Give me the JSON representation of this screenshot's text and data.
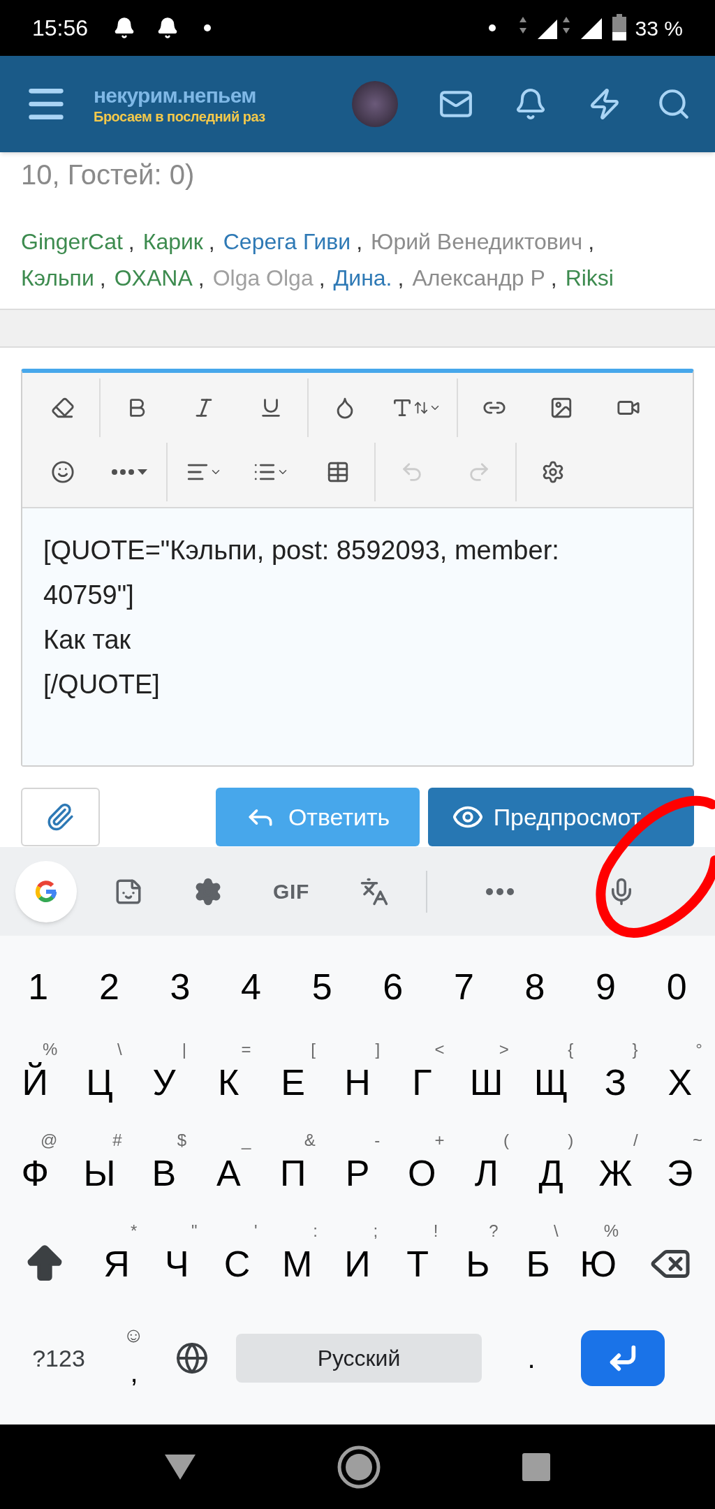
{
  "status_bar": {
    "time": "15:56",
    "battery": "33 %"
  },
  "header": {
    "logo_title": "некурим.непьем",
    "logo_subtitle": "Бросаем в последний раз"
  },
  "online": {
    "partial_text": "10, Гостей: 0)",
    "separator": ",",
    "members": [
      {
        "name": "GingerCat",
        "color": "#3d8b4f"
      },
      {
        "name": "Карик",
        "color": "#3d8b4f"
      },
      {
        "name": "Серега Гиви",
        "color": "#2e79b5"
      },
      {
        "name": "Юрий Венедиктович",
        "color": "#8c8c8c"
      },
      {
        "name": "Кэльпи",
        "color": "#3d8b4f"
      },
      {
        "name": "OXANA",
        "color": "#3d8b4f"
      },
      {
        "name": "Olga Olga",
        "color": "#a0a0a0"
      },
      {
        "name": "Дина.",
        "color": "#2e79b5"
      },
      {
        "name": "Александр Р",
        "color": "#8c8c8c"
      },
      {
        "name": "Riksi",
        "color": "#3d8b4f"
      }
    ]
  },
  "toolbar": {
    "rows": [
      [
        {
          "kind": "eraser",
          "disabled": false
        },
        {
          "kind": "divider"
        },
        {
          "kind": "bold",
          "disabled": false
        },
        {
          "kind": "italic",
          "disabled": false
        },
        {
          "kind": "underline",
          "disabled": false
        },
        {
          "kind": "divider"
        },
        {
          "kind": "color",
          "disabled": false
        },
        {
          "kind": "size",
          "disabled": false
        },
        {
          "kind": "divider"
        },
        {
          "kind": "link",
          "disabled": false
        },
        {
          "kind": "image",
          "disabled": false
        },
        {
          "kind": "video",
          "disabled": false
        }
      ],
      [
        {
          "kind": "smile",
          "disabled": false
        },
        {
          "kind": "more",
          "disabled": false
        },
        {
          "kind": "divider"
        },
        {
          "kind": "align",
          "disabled": false
        },
        {
          "kind": "list",
          "disabled": false
        },
        {
          "kind": "table",
          "disabled": false
        },
        {
          "kind": "divider"
        },
        {
          "kind": "undo",
          "disabled": true
        },
        {
          "kind": "redo",
          "disabled": true
        },
        {
          "kind": "divider"
        },
        {
          "kind": "settings",
          "disabled": false
        }
      ]
    ]
  },
  "editor": {
    "lines": [
      "[QUOTE=\"Кэльпи, post: 8592093, member:",
      "40759\"]",
      "Как так",
      "[/QUOTE]"
    ]
  },
  "actions": {
    "reply": "Ответить",
    "preview": "Предпросмот"
  },
  "keyboard": {
    "strip": [
      {
        "kind": "google"
      },
      {
        "kind": "sticker"
      },
      {
        "kind": "settings"
      },
      {
        "kind": "gif",
        "label": "GIF"
      },
      {
        "kind": "translate"
      },
      {
        "kind": "divider"
      },
      {
        "kind": "more"
      },
      {
        "kind": "mic"
      }
    ],
    "number_row": [
      "1",
      "2",
      "3",
      "4",
      "5",
      "6",
      "7",
      "8",
      "9",
      "0"
    ],
    "letter_rows": [
      [
        {
          "label": "Й",
          "hint": "%"
        },
        {
          "label": "Ц",
          "hint": "\\"
        },
        {
          "label": "У",
          "hint": "|"
        },
        {
          "label": "К",
          "hint": "="
        },
        {
          "label": "Е",
          "hint": "["
        },
        {
          "label": "Н",
          "hint": "]"
        },
        {
          "label": "Г",
          "hint": "<"
        },
        {
          "label": "Ш",
          "hint": ">"
        },
        {
          "label": "Щ",
          "hint": "{"
        },
        {
          "label": "З",
          "hint": "}"
        },
        {
          "label": "Х",
          "hint": "°"
        }
      ],
      [
        {
          "label": "Ф",
          "hint": "@"
        },
        {
          "label": "Ы",
          "hint": "#"
        },
        {
          "label": "В",
          "hint": "$"
        },
        {
          "label": "А",
          "hint": "_"
        },
        {
          "label": "П",
          "hint": "&"
        },
        {
          "label": "Р",
          "hint": "-"
        },
        {
          "label": "О",
          "hint": "+"
        },
        {
          "label": "Л",
          "hint": "("
        },
        {
          "label": "Д",
          "hint": ")"
        },
        {
          "label": "Ж",
          "hint": "/"
        },
        {
          "label": "Э",
          "hint": "~"
        }
      ],
      [
        {
          "label": "Я",
          "hint": "*"
        },
        {
          "label": "Ч",
          "hint": "\""
        },
        {
          "label": "С",
          "hint": "'"
        },
        {
          "label": "М",
          "hint": ":"
        },
        {
          "label": "И",
          "hint": ";"
        },
        {
          "label": "Т",
          "hint": "!"
        },
        {
          "label": "Ь",
          "hint": "?"
        },
        {
          "label": "Б",
          "hint": "\\"
        },
        {
          "label": "Ю",
          "hint": "%"
        }
      ]
    ],
    "symbols_key": "?123",
    "comma_key": ",",
    "comma_hint": "☺",
    "space_key": "Русский",
    "period_key": "."
  }
}
